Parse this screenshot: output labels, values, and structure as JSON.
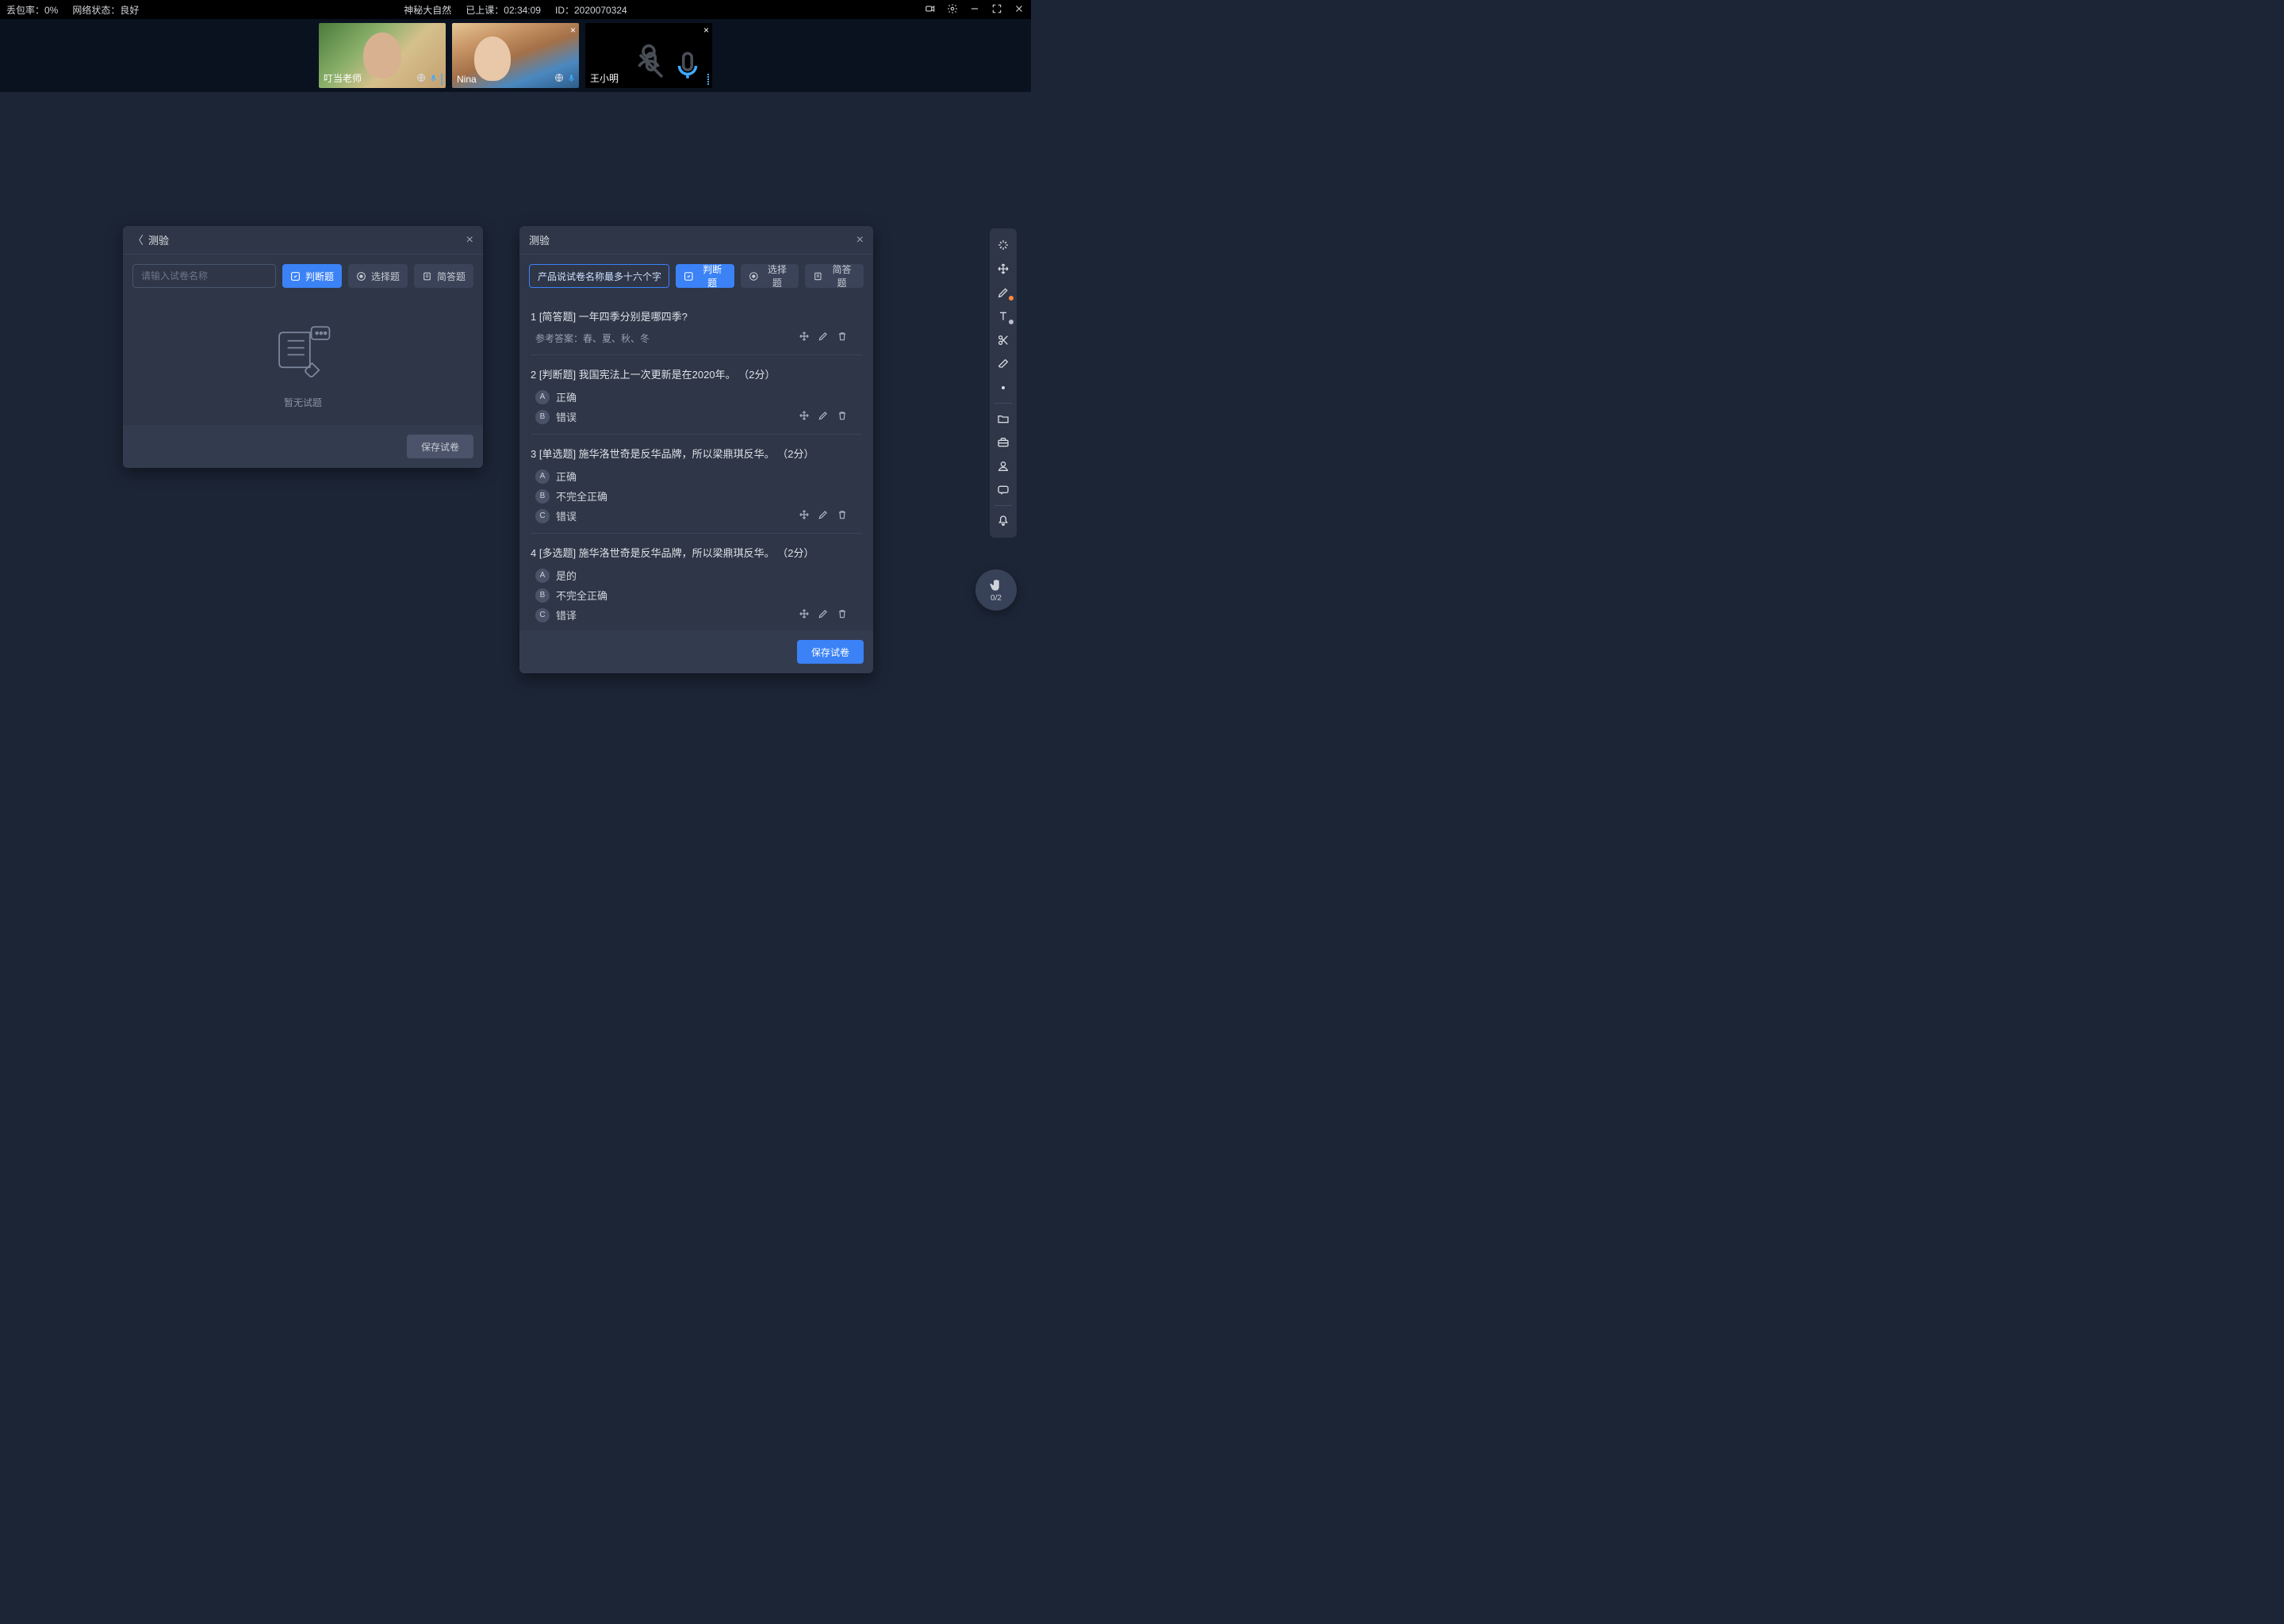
{
  "status": {
    "packet_loss_label": "丢包率：0%",
    "network_label": "网络状态：良好",
    "course_title": "神秘大自然",
    "elapsed_label": "已上课：02:34:09",
    "session_id_label": "ID：2020070324"
  },
  "participants": [
    {
      "name": "叮当老师",
      "camera_on": true,
      "has_close": false,
      "mic_color": "#3faaff",
      "mic_muted": false
    },
    {
      "name": "Nina",
      "camera_on": true,
      "has_close": true,
      "mic_color": "#3faaff",
      "mic_muted": false
    },
    {
      "name": "王小明",
      "camera_on": false,
      "has_close": true,
      "mic_color": "#3faaff",
      "mic_muted": true
    }
  ],
  "panel_empty": {
    "title": "测验",
    "input_placeholder": "请输入试卷名称",
    "btn_judge": "判断题",
    "btn_choice": "选择题",
    "btn_short": "简答题",
    "empty_text": "暂无试题",
    "save_btn": "保存试卷"
  },
  "panel_quiz": {
    "title": "测验",
    "paper_name": "产品说试卷名称最多十六个字",
    "btn_judge": "判断题",
    "btn_choice": "选择题",
    "btn_short": "简答题",
    "save_btn": "保存试卷",
    "ref_answer_label": "参考答案：春、夏、秋、冬",
    "questions": [
      {
        "num": "1",
        "tag": "[简答题]",
        "text": "一年四季分别是哪四季?",
        "score": "",
        "options": []
      },
      {
        "num": "2",
        "tag": "[判断题]",
        "text": "我国宪法上一次更新是在2020年。",
        "score": "（2分）",
        "options": [
          {
            "k": "A",
            "t": "正确"
          },
          {
            "k": "B",
            "t": "错误"
          }
        ]
      },
      {
        "num": "3",
        "tag": "[单选题]",
        "text": "施华洛世奇是反华品牌，所以梁鼎琪反华。",
        "score": "（2分）",
        "options": [
          {
            "k": "A",
            "t": "正确"
          },
          {
            "k": "B",
            "t": "不完全正确"
          },
          {
            "k": "C",
            "t": "错误"
          }
        ]
      },
      {
        "num": "4",
        "tag": "[多选题]",
        "text": "施华洛世奇是反华品牌，所以梁鼎琪反华。",
        "score": "（2分）",
        "options": [
          {
            "k": "A",
            "t": "是的"
          },
          {
            "k": "B",
            "t": "不完全正确"
          },
          {
            "k": "C",
            "t": "错译"
          }
        ]
      }
    ]
  },
  "hand": {
    "count": "0/2"
  }
}
